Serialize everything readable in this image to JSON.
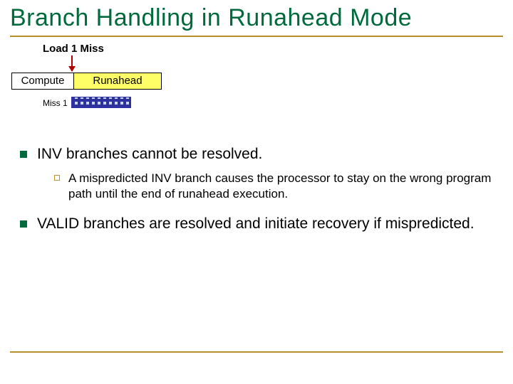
{
  "title": "Branch Handling in Runahead Mode",
  "diagram": {
    "load_miss": "Load 1 Miss",
    "compute": "Compute",
    "runahead": "Runahead",
    "miss1": "Miss 1"
  },
  "bullets": {
    "b1": "INV branches cannot be resolved.",
    "b1_sub": "A mispredicted INV branch causes the processor to stay on the wrong program path until the end of runahead execution.",
    "b2": "VALID branches are resolved and initiate recovery if mispredicted."
  }
}
